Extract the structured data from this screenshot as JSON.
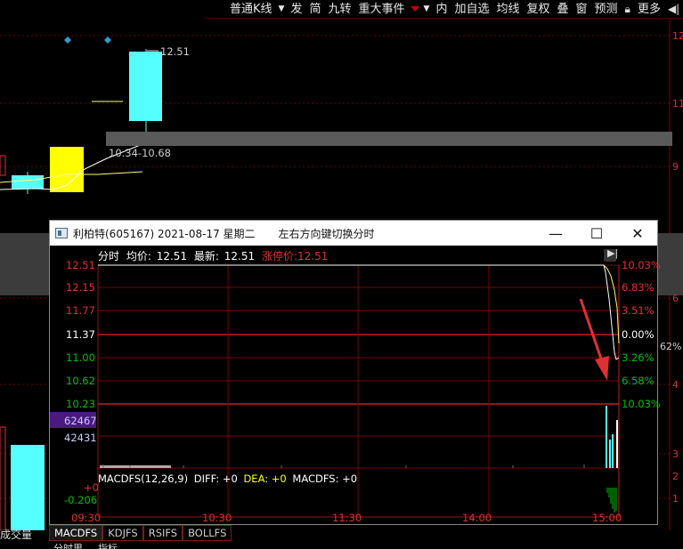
{
  "toolbar": {
    "kline_type": "普通K线",
    "items": [
      "发",
      "简",
      "九转",
      "重大事件",
      "内",
      "加自选",
      "均线",
      "复权",
      "叠",
      "窗",
      "预测",
      "更多"
    ]
  },
  "background_chart": {
    "price_label": "12.51",
    "range_label": "10.34-10.68",
    "right_axis_values": [
      "12",
      "11",
      "9",
      "6",
      "4",
      "3",
      "2",
      "1"
    ],
    "right_partial_text": "62%"
  },
  "popup": {
    "title": "利柏特(605167) 2021-08-17 星期二",
    "hint": "左右方向键切换分时",
    "minimize_icon": "minimize-icon",
    "maximize_icon": "maximize-icon",
    "close_icon": "close-icon",
    "info_bar": {
      "mode": "分时",
      "avg_label": "均价:",
      "avg_value": "12.51",
      "latest_label": "最新:",
      "latest_value": "12.51",
      "limit_label": "涨停价:",
      "limit_value": "12.51"
    },
    "left_axis": [
      "12.51",
      "12.15",
      "11.77",
      "11.37",
      "11.00",
      "10.62",
      "10.23"
    ],
    "right_axis": [
      "10.03%",
      "6.83%",
      "3.51%",
      "0.00%",
      "3.26%",
      "6.58%",
      "10.03%"
    ],
    "volume_axis": [
      "62467",
      "42431"
    ],
    "macd_label": "MACDFS(12,26,9)",
    "macd_diff": "DIFF: +0",
    "macd_dea": "DEA: +0",
    "macd_value": "MACDFS: +0",
    "macd_axis": [
      "+0",
      "-0.206"
    ],
    "time_axis": [
      "09:30",
      "10:30",
      "11:30",
      "14:00",
      "15:00"
    ]
  },
  "tabs": {
    "items": [
      "MACDFS",
      "KDJFS",
      "RSIFS",
      "BOLLFS"
    ],
    "active": "MACDFS"
  },
  "bottom": {
    "left_label": "成交量",
    "left_label2": "分时里",
    "left_label3": "指标"
  },
  "colors": {
    "up_red": "#e03030",
    "down_green": "#00c000",
    "cyan": "#55ffff",
    "yellow": "#ffff00",
    "grid_red": "#8b0000",
    "price_line": "#ffffff"
  }
}
